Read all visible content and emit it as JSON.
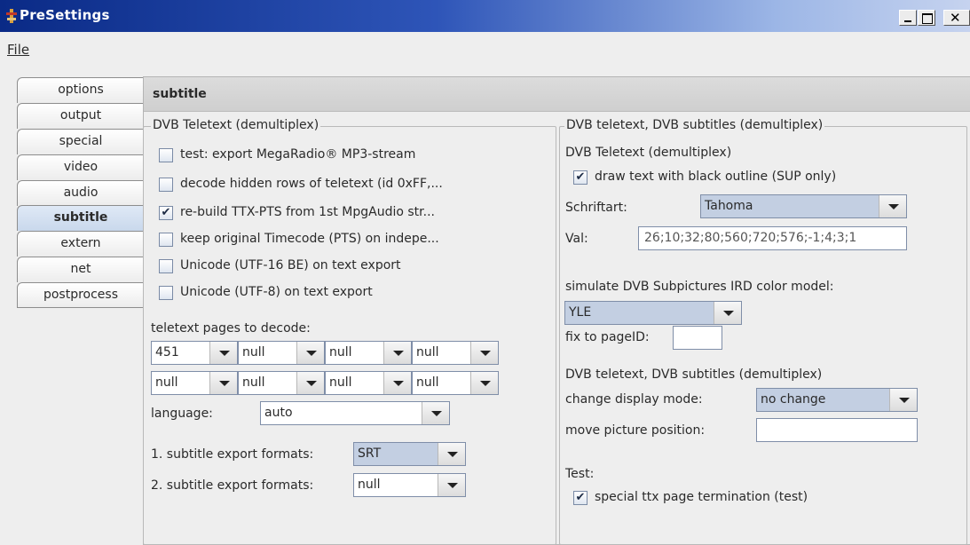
{
  "window": {
    "title": "PreSettings"
  },
  "menu": {
    "file": "File"
  },
  "tabs": [
    {
      "label": "options"
    },
    {
      "label": "output"
    },
    {
      "label": "special"
    },
    {
      "label": "video"
    },
    {
      "label": "audio"
    },
    {
      "label": "subtitle"
    },
    {
      "label": "extern"
    },
    {
      "label": "net"
    },
    {
      "label": "postprocess"
    }
  ],
  "active_tab": "subtitle",
  "panel": {
    "title": "subtitle",
    "left": {
      "legend": "DVB Teletext (demultiplex)",
      "options": [
        {
          "label": "test: export MegaRadio® MP3-stream",
          "checked": false
        },
        {
          "label": "decode hidden rows of teletext (id 0xFF,...",
          "checked": false
        },
        {
          "label": "re-build TTX-PTS from 1st MpgAudio str...",
          "checked": true
        },
        {
          "label": "keep original Timecode (PTS) on indepe...",
          "checked": false
        },
        {
          "label": "Unicode (UTF-16 BE) on text export",
          "checked": false
        },
        {
          "label": "Unicode (UTF-8) on text export",
          "checked": false
        }
      ],
      "pages_label": "teletext pages to decode:",
      "pages": [
        "451",
        "null",
        "null",
        "null",
        "null",
        "null",
        "null",
        "null"
      ],
      "language_label": "language:",
      "language": "auto",
      "export1_label": "1. subtitle export formats:",
      "export1": "SRT",
      "export2_label": "2. subtitle export formats:",
      "export2": "null"
    },
    "right": {
      "legend": "DVB teletext, DVB subtitles (demultiplex)",
      "section1": "DVB Teletext (demultiplex)",
      "outline": {
        "label": "draw text with black outline (SUP only)",
        "checked": true
      },
      "font_label": "Schriftart:",
      "font": "Tahoma",
      "val_label": "Val:",
      "val": "26;10;32;80;560;720;576;-1;4;3;1",
      "simulate_label": "simulate DVB Subpictures IRD color model:",
      "color_model": "YLE",
      "pageid_label": "fix to pageID:",
      "pageid": "",
      "section2": "DVB teletext, DVB subtitles (demultiplex)",
      "display_label": "change display mode:",
      "display_mode": "no change",
      "move_label": "move picture position:",
      "move": "",
      "test_label": "Test:",
      "special": {
        "label": "special ttx page termination (test)",
        "checked": true
      }
    }
  },
  "check_glyph": "✔",
  "icons": {
    "app": "app-icon",
    "min": "minimize-icon",
    "max": "maximize-icon",
    "close": "close-icon"
  }
}
